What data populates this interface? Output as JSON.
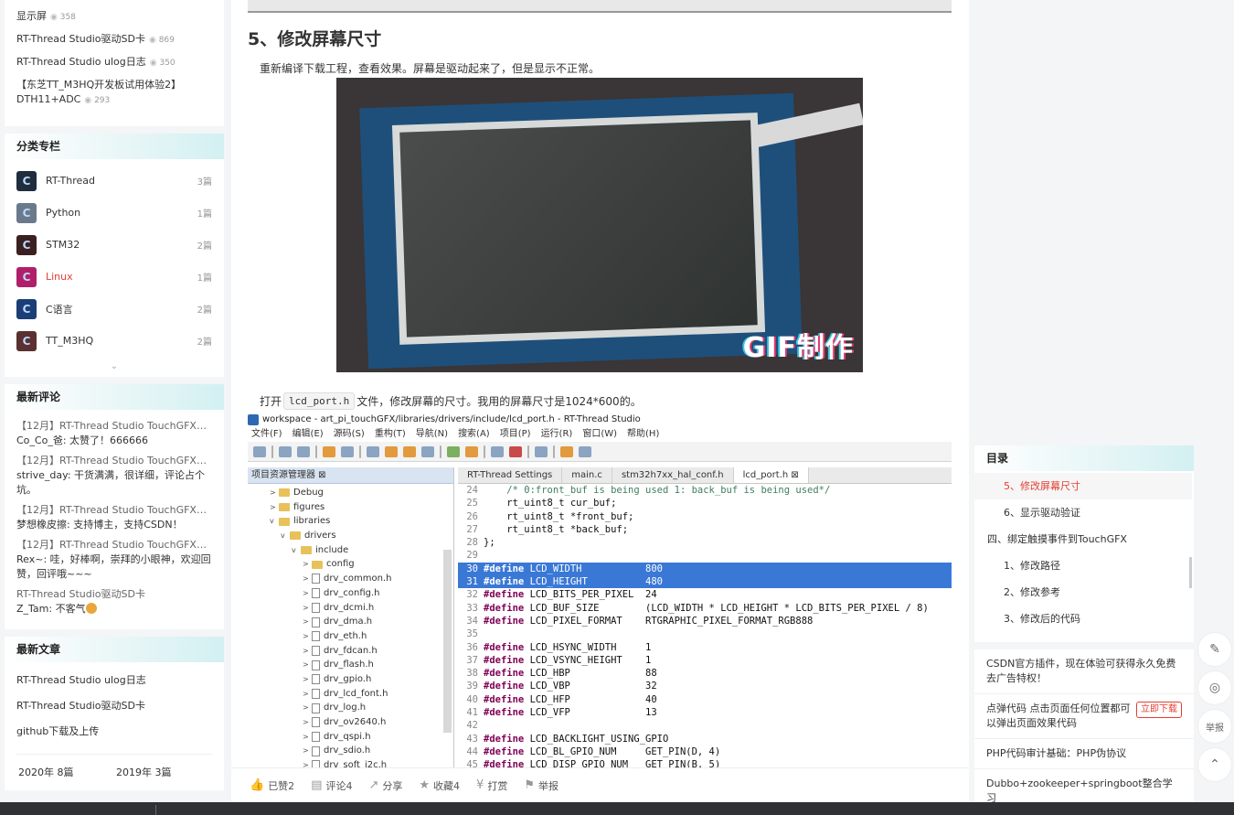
{
  "hot_articles": [
    {
      "title": "显示屏",
      "views": "358"
    },
    {
      "title": "RT-Thread Studio驱动SD卡",
      "views": "869"
    },
    {
      "title": "RT-Thread Studio ulog日志",
      "views": "350"
    },
    {
      "title": "【东芝TT_M3HQ开发板试用体验2】DTH11+ADC",
      "views": "293"
    }
  ],
  "columns": {
    "heading": "分类专栏",
    "items": [
      {
        "name": "RT-Thread",
        "count": "3篇",
        "color": "#1f2d3d"
      },
      {
        "name": "Python",
        "count": "1篇",
        "color": "#6a7a8c"
      },
      {
        "name": "STM32",
        "count": "2篇",
        "color": "#3a2020"
      },
      {
        "name": "Linux",
        "count": "1篇",
        "color": "#b0206a"
      },
      {
        "name": "C语言",
        "count": "2篇",
        "color": "#1a3e75"
      },
      {
        "name": "TT_M3HQ",
        "count": "2篇",
        "color": "#5a3030"
      }
    ],
    "more": "⌄"
  },
  "comments": {
    "heading": "最新评论",
    "items": [
      {
        "title": "【12月】RT-Thread Studio TouchGFX驱...",
        "body": "Co_Co_爸: 太赞了！666666"
      },
      {
        "title": "【12月】RT-Thread Studio TouchGFX驱...",
        "body": "strive_day: 干货满满，很详细，评论占个坑。"
      },
      {
        "title": "【12月】RT-Thread Studio TouchGFX驱...",
        "body": "梦想橡皮擦: 支持博主，支持CSDN！"
      },
      {
        "title": "【12月】RT-Thread Studio TouchGFX驱...",
        "body": "Rex~: 哇，好棒啊，崇拜的小眼神，欢迎回赞，回评哦~~~"
      },
      {
        "title": "RT-Thread Studio驱动SD卡",
        "body": "Z_Tam: 不客气"
      }
    ]
  },
  "new_articles": {
    "heading": "最新文章",
    "items": [
      "RT-Thread Studio ulog日志",
      "RT-Thread Studio驱动SD卡",
      "github下载及上传"
    ],
    "archive": [
      "2020年  8篇",
      "2019年  3篇"
    ]
  },
  "article": {
    "section_title": "5、修改屏幕尺寸",
    "para1": "重新编译下载工程，查看效果。屏幕是驱动起来了，但是显示不正常。",
    "gif_mark": "GIF制作",
    "para2_before": "打开",
    "para2_code": "lcd_port.h",
    "para2_after": "文件，修改屏幕的尺寸。我用的屏幕尺寸是1024*600的。"
  },
  "ide": {
    "title": "workspace - art_pi_touchGFX/libraries/drivers/include/lcd_port.h - RT-Thread Studio",
    "menu": [
      "文件(F)",
      "编辑(E)",
      "源码(S)",
      "重构(T)",
      "导航(N)",
      "搜索(A)",
      "项目(P)",
      "运行(R)",
      "窗口(W)",
      "帮助(H)"
    ],
    "explorer_title": "项目资源管理器 ⊠",
    "tree": [
      {
        "label": "Debug",
        "depth": 1,
        "type": "folder",
        "twisty": ">"
      },
      {
        "label": "figures",
        "depth": 1,
        "type": "folder",
        "twisty": ">"
      },
      {
        "label": "libraries",
        "depth": 1,
        "type": "folder",
        "twisty": "v"
      },
      {
        "label": "drivers",
        "depth": 2,
        "type": "folder",
        "twisty": "v"
      },
      {
        "label": "include",
        "depth": 3,
        "type": "folder",
        "twisty": "v"
      },
      {
        "label": "config",
        "depth": 4,
        "type": "folder",
        "twisty": ">"
      },
      {
        "label": "drv_common.h",
        "depth": 4,
        "type": "file",
        "twisty": ">"
      },
      {
        "label": "drv_config.h",
        "depth": 4,
        "type": "file",
        "twisty": ">"
      },
      {
        "label": "drv_dcmi.h",
        "depth": 4,
        "type": "file",
        "twisty": ">"
      },
      {
        "label": "drv_dma.h",
        "depth": 4,
        "type": "file",
        "twisty": ">"
      },
      {
        "label": "drv_eth.h",
        "depth": 4,
        "type": "file",
        "twisty": ">"
      },
      {
        "label": "drv_fdcan.h",
        "depth": 4,
        "type": "file",
        "twisty": ">"
      },
      {
        "label": "drv_flash.h",
        "depth": 4,
        "type": "file",
        "twisty": ">"
      },
      {
        "label": "drv_gpio.h",
        "depth": 4,
        "type": "file",
        "twisty": ">"
      },
      {
        "label": "drv_lcd_font.h",
        "depth": 4,
        "type": "file",
        "twisty": ">"
      },
      {
        "label": "drv_log.h",
        "depth": 4,
        "type": "file",
        "twisty": ">"
      },
      {
        "label": "drv_ov2640.h",
        "depth": 4,
        "type": "file",
        "twisty": ">"
      },
      {
        "label": "drv_qspi.h",
        "depth": 4,
        "type": "file",
        "twisty": ">"
      },
      {
        "label": "drv_sdio.h",
        "depth": 4,
        "type": "file",
        "twisty": ">"
      },
      {
        "label": "drv_soft_i2c.h",
        "depth": 4,
        "type": "file",
        "twisty": ">"
      }
    ],
    "tabs": [
      {
        "label": "RT-Thread Settings",
        "active": false
      },
      {
        "label": "main.c",
        "active": false
      },
      {
        "label": "stm32h7xx_hal_conf.h",
        "active": false
      },
      {
        "label": "lcd_port.h ⊠",
        "active": true
      }
    ],
    "code": [
      {
        "n": "24",
        "pre": "    ",
        "kw": "",
        "rest": "/* 0:front_buf is being used 1: back_buf is being used*/",
        "comment": true,
        "sel": false
      },
      {
        "n": "25",
        "pre": "    ",
        "kw": "",
        "rest": "rt_uint8_t cur_buf;",
        "comment": false,
        "sel": false
      },
      {
        "n": "26",
        "pre": "    ",
        "kw": "",
        "rest": "rt_uint8_t *front_buf;",
        "comment": false,
        "sel": false
      },
      {
        "n": "27",
        "pre": "    ",
        "kw": "",
        "rest": "rt_uint8_t *back_buf;",
        "comment": false,
        "sel": false
      },
      {
        "n": "28",
        "pre": "",
        "kw": "",
        "rest": "};",
        "comment": false,
        "sel": false
      },
      {
        "n": "29",
        "pre": "",
        "kw": "",
        "rest": "",
        "comment": false,
        "sel": false
      },
      {
        "n": "30",
        "pre": "",
        "kw": "#define",
        "rest": " LCD_WIDTH           800",
        "comment": false,
        "sel": true
      },
      {
        "n": "31",
        "pre": "",
        "kw": "#define",
        "rest": " LCD_HEIGHT          480",
        "comment": false,
        "sel": true
      },
      {
        "n": "32",
        "pre": "",
        "kw": "#define",
        "rest": " LCD_BITS_PER_PIXEL  24",
        "comment": false,
        "sel": false
      },
      {
        "n": "33",
        "pre": "",
        "kw": "#define",
        "rest": " LCD_BUF_SIZE        (LCD_WIDTH * LCD_HEIGHT * LCD_BITS_PER_PIXEL / 8)",
        "comment": false,
        "sel": false
      },
      {
        "n": "34",
        "pre": "",
        "kw": "#define",
        "rest": " LCD_PIXEL_FORMAT    RTGRAPHIC_PIXEL_FORMAT_RGB888",
        "comment": false,
        "sel": false
      },
      {
        "n": "35",
        "pre": "",
        "kw": "",
        "rest": "",
        "comment": false,
        "sel": false
      },
      {
        "n": "36",
        "pre": "",
        "kw": "#define",
        "rest": " LCD_HSYNC_WIDTH     1",
        "comment": false,
        "sel": false
      },
      {
        "n": "37",
        "pre": "",
        "kw": "#define",
        "rest": " LCD_VSYNC_HEIGHT    1",
        "comment": false,
        "sel": false
      },
      {
        "n": "38",
        "pre": "",
        "kw": "#define",
        "rest": " LCD_HBP             88",
        "comment": false,
        "sel": false
      },
      {
        "n": "39",
        "pre": "",
        "kw": "#define",
        "rest": " LCD_VBP             32",
        "comment": false,
        "sel": false
      },
      {
        "n": "40",
        "pre": "",
        "kw": "#define",
        "rest": " LCD_HFP             40",
        "comment": false,
        "sel": false
      },
      {
        "n": "41",
        "pre": "",
        "kw": "#define",
        "rest": " LCD_VFP             13",
        "comment": false,
        "sel": false
      },
      {
        "n": "42",
        "pre": "",
        "kw": "",
        "rest": "",
        "comment": false,
        "sel": false
      },
      {
        "n": "43",
        "pre": "",
        "kw": "#define",
        "rest": " LCD_BACKLIGHT_USING_GPIO",
        "comment": false,
        "sel": false
      },
      {
        "n": "44",
        "pre": "",
        "kw": "#define",
        "rest": " LCD_BL_GPIO_NUM     GET_PIN(D, 4)",
        "comment": false,
        "sel": false
      },
      {
        "n": "45",
        "pre": "",
        "kw": "#define",
        "rest": " LCD_DISP_GPIO_NUM   GET_PIN(B, 5)",
        "comment": false,
        "sel": false
      }
    ]
  },
  "actions": [
    {
      "icon": "👍",
      "label": "已赞2",
      "active": true
    },
    {
      "icon": "▤",
      "label": "评论4",
      "active": false
    },
    {
      "icon": "↗",
      "label": "分享",
      "active": false
    },
    {
      "icon": "★",
      "label": "收藏4",
      "active": false
    },
    {
      "icon": "¥",
      "label": "打赏",
      "active": false
    },
    {
      "icon": "⚑",
      "label": "举报",
      "active": false
    }
  ],
  "toc": {
    "heading": "目录",
    "items": [
      {
        "label": "5、修改屏幕尺寸",
        "level": 2,
        "active": true
      },
      {
        "label": "6、显示驱动验证",
        "level": 2,
        "active": false
      },
      {
        "label": "四、绑定触摸事件到TouchGFX",
        "level": 1,
        "active": false
      },
      {
        "label": "1、修改路径",
        "level": 2,
        "active": false
      },
      {
        "label": "2、修改参考",
        "level": 2,
        "active": false
      },
      {
        "label": "3、修改后的代码",
        "level": 2,
        "active": false
      }
    ]
  },
  "recommend": [
    {
      "text": "CSDN官方插件，现在体验可获得永久免费去广告特权！",
      "button": ""
    },
    {
      "text": "点弹代码 点击页面任何位置都可以弹出页面效果代码",
      "button": "立即下载"
    },
    {
      "text": "PHP代码审计基础：PHP伪协议",
      "button": ""
    },
    {
      "text": "Dubbo+zookeeper+springboot整合学习",
      "button": ""
    }
  ],
  "tools": [
    {
      "name": "edit-icon",
      "glyph": "✎"
    },
    {
      "name": "headset-icon",
      "glyph": "◎"
    },
    {
      "name": "report-tool",
      "glyph": "举报"
    },
    {
      "name": "back-to-top-icon",
      "glyph": "⌃"
    }
  ]
}
